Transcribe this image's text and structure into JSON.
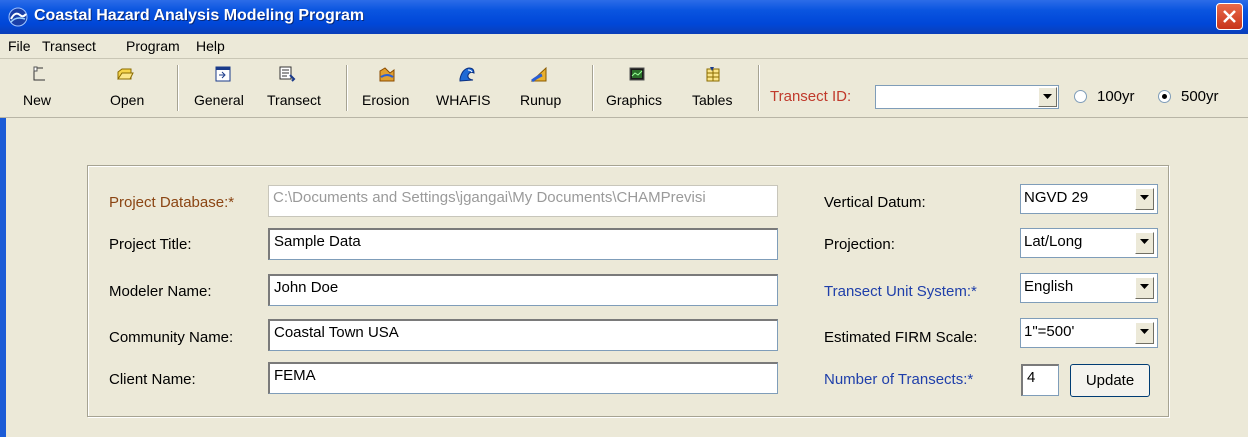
{
  "window": {
    "title": "Coastal Hazard Analysis Modeling Program"
  },
  "menu": [
    "File",
    "Transect",
    "Program",
    "Help"
  ],
  "toolbar": {
    "buttons": [
      {
        "label": "New",
        "icon": "new-icon"
      },
      {
        "label": "Open",
        "icon": "open-folder-icon"
      },
      {
        "label": "General",
        "icon": "general-icon"
      },
      {
        "label": "Transect",
        "icon": "transect-icon"
      },
      {
        "label": "Erosion",
        "icon": "erosion-icon"
      },
      {
        "label": "WHAFIS",
        "icon": "whafis-wave-icon"
      },
      {
        "label": "Runup",
        "icon": "runup-icon"
      },
      {
        "label": "Graphics",
        "icon": "graphics-icon"
      },
      {
        "label": "Tables",
        "icon": "tables-icon"
      }
    ],
    "transect_id_label": "Transect ID:",
    "transect_id_value": "",
    "radio_100yr": "100yr",
    "radio_500yr": "500yr",
    "selected_return_period": "500yr"
  },
  "form": {
    "project_database_label": "Project Database:*",
    "project_database_value": "C:\\Documents and Settings\\jgangai\\My Documents\\CHAMPrevisi",
    "project_title_label": "Project Title:",
    "project_title_value": "Sample Data",
    "modeler_name_label": "Modeler Name:",
    "modeler_name_value": "John Doe",
    "community_name_label": "Community Name:",
    "community_name_value": "Coastal Town USA",
    "client_name_label": "Client Name:",
    "client_name_value": "FEMA",
    "vertical_datum_label": "Vertical Datum:",
    "vertical_datum_value": "NGVD 29",
    "projection_label": "Projection:",
    "projection_value": "Lat/Long",
    "unit_system_label": "Transect Unit System:*",
    "unit_system_value": "English",
    "firm_scale_label": "Estimated FIRM Scale:",
    "firm_scale_value": "1\"=500'",
    "num_transects_label": "Number of Transects:*",
    "num_transects_value": "4",
    "update_label": "Update"
  },
  "colors": {
    "titlebar": "#0A55E0",
    "required_brown": "#8B4513",
    "required_blue": "#1F3FAA",
    "transect_id_red": "#C0392B",
    "window_bg": "#ECE9D8"
  }
}
